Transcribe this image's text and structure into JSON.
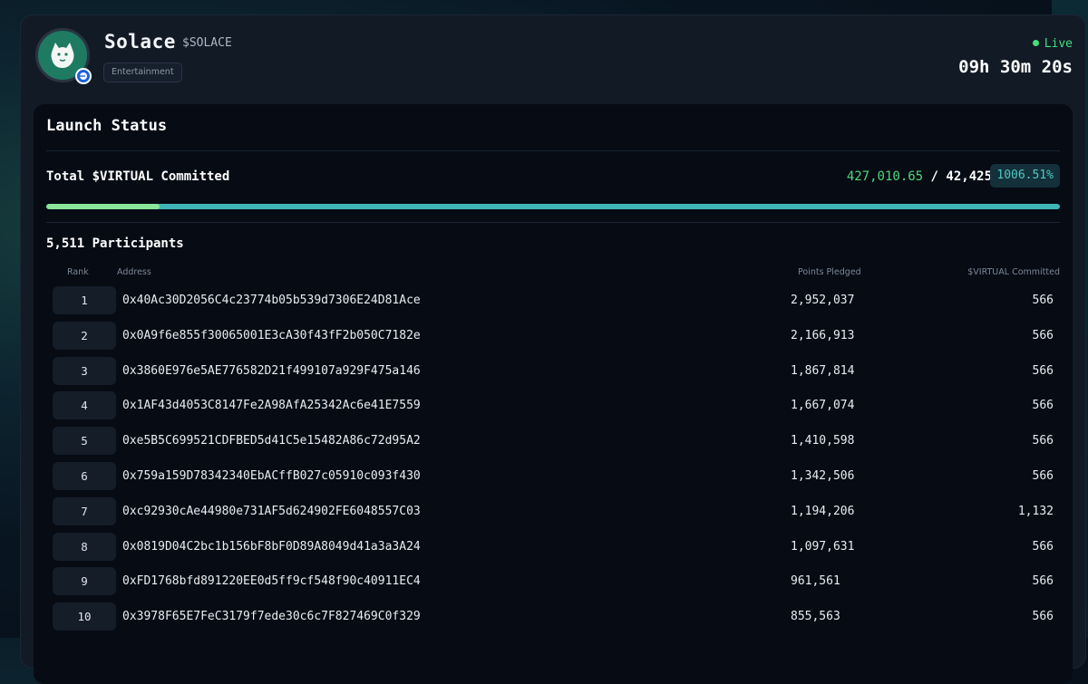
{
  "token": {
    "name": "Solace",
    "ticker": "$SOLACE",
    "category": "Entertainment",
    "logo_icon": "white-creature-logo-icon",
    "chain_badge_icon": "base-chain-icon"
  },
  "status": {
    "live_label": "Live",
    "countdown": "09h 30m 20s"
  },
  "launch": {
    "title": "Launch Status",
    "commit_label": "Total $VIRTUAL Committed",
    "committed": "427,010.65",
    "separator": "/",
    "target": "42,425",
    "percent": "1006.51%",
    "progress_fraction": 1.0,
    "participants": "5,511 Participants"
  },
  "table": {
    "headers": {
      "rank": "Rank",
      "address": "Address",
      "points": "Points Pledged",
      "virtual": "$VIRTUAL Committed"
    },
    "rows": [
      {
        "rank": "1",
        "address": "0x40Ac30D2056C4c23774b05b539d7306E24D81Ace",
        "points": "2,952,037",
        "virtual": "566"
      },
      {
        "rank": "2",
        "address": "0x0A9f6e855f30065001E3cA30f43fF2b050C7182e",
        "points": "2,166,913",
        "virtual": "566"
      },
      {
        "rank": "3",
        "address": "0x3860E976e5AE776582D21f499107a929F475a146",
        "points": "1,867,814",
        "virtual": "566"
      },
      {
        "rank": "4",
        "address": "0x1AF43d4053C8147Fe2A98AfA25342Ac6e41E7559",
        "points": "1,667,074",
        "virtual": "566"
      },
      {
        "rank": "5",
        "address": "0xe5B5C699521CDFBED5d41C5e15482A86c72d95A2",
        "points": "1,410,598",
        "virtual": "566"
      },
      {
        "rank": "6",
        "address": "0x759a159D783423​40EbACffB027c05910c093f430",
        "points": "1,342,506",
        "virtual": "566"
      },
      {
        "rank": "7",
        "address": "0xc92930cAe44980e731AF5d624902FE6048557C03",
        "points": "1,194,206",
        "virtual": "1,132"
      },
      {
        "rank": "8",
        "address": "0x0819D04C2bc1b156bF8bF0D89A8049d41a3a3A24",
        "points": "1,097,631",
        "virtual": "566"
      },
      {
        "rank": "9",
        "address": "0xFD1768bfd891220EE0d5ff9cf548f90c40911EC4",
        "points": "961,561",
        "virtual": "566"
      },
      {
        "rank": "10",
        "address": "0x3978F65E7FeC3179f7ede30c6c7F827469C0f329",
        "points": "855,563",
        "virtual": "566"
      }
    ]
  },
  "colors": {
    "accent_green": "#4fd87b",
    "accent_teal": "#3fb5b8",
    "live_green": "#45e07b"
  }
}
